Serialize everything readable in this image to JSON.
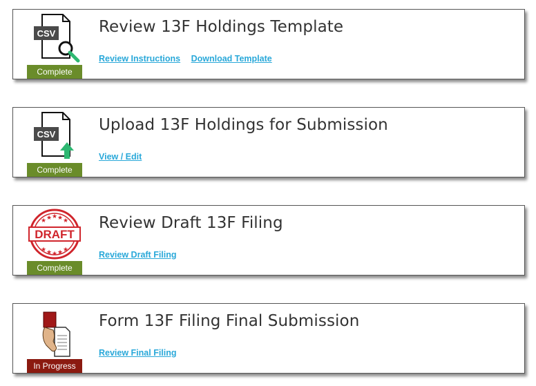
{
  "colors": {
    "complete_badge": "#6a8c2a",
    "in_progress_badge": "#8b1a10",
    "link": "#29a8d9",
    "title_text": "#333333",
    "upload_arrow": "#2eb872",
    "search_lens": "#2eb872",
    "draft_stamp": "#d0252c"
  },
  "steps": [
    {
      "title": "Review 13F Holdings Template",
      "status": "Complete",
      "icon": "csv-search-icon",
      "icon_text": "CSV",
      "links": [
        "Review Instructions",
        "Download Template"
      ]
    },
    {
      "title": "Upload 13F Holdings for Submission",
      "status": "Complete",
      "icon": "csv-upload-icon",
      "icon_text": "CSV",
      "links": [
        "View / Edit"
      ]
    },
    {
      "title": "Review Draft 13F Filing",
      "status": "Complete",
      "icon": "draft-stamp-icon",
      "icon_text": "DRAFT",
      "links": [
        "Review Draft Filing"
      ]
    },
    {
      "title": "Form 13F Filing Final Submission",
      "status": "In Progress",
      "icon": "hand-document-icon",
      "links": [
        "Review Final Filing"
      ]
    }
  ]
}
